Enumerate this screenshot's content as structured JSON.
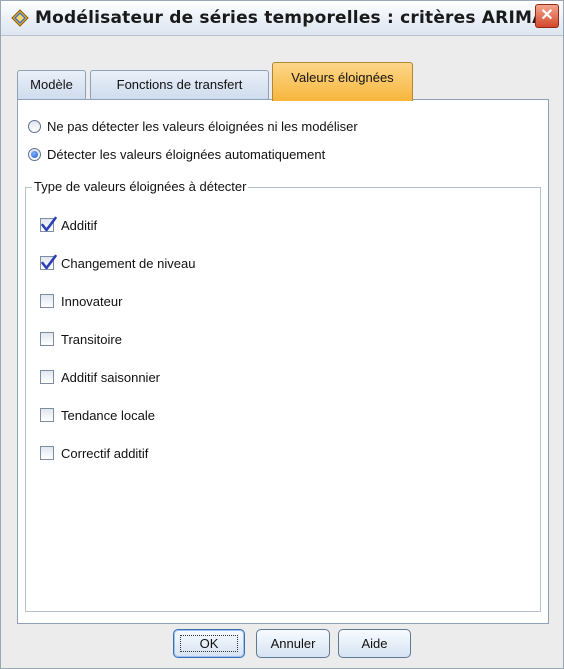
{
  "window": {
    "title": "Modélisateur de séries temporelles : critères ARIMA",
    "close_label": "✕"
  },
  "tabs": [
    {
      "label": "Modèle",
      "active": false
    },
    {
      "label": "Fonctions de transfert",
      "active": false
    },
    {
      "label": "Valeurs éloignées",
      "active": true
    }
  ],
  "detection": {
    "options": [
      {
        "label": "Ne pas détecter les valeurs éloignées ni les modéliser",
        "selected": false
      },
      {
        "label": "Détecter les valeurs éloignées automatiquement",
        "selected": true
      }
    ]
  },
  "outlier_types": {
    "legend": "Type de valeurs éloignées à détecter",
    "items": [
      {
        "label": "Additif",
        "checked": true
      },
      {
        "label": "Changement de niveau",
        "checked": true
      },
      {
        "label": "Innovateur",
        "checked": false
      },
      {
        "label": "Transitoire",
        "checked": false
      },
      {
        "label": "Additif saisonnier",
        "checked": false
      },
      {
        "label": "Tendance locale",
        "checked": false
      },
      {
        "label": "Correctif additif",
        "checked": false
      }
    ]
  },
  "buttons": {
    "ok": "OK",
    "cancel": "Annuler",
    "help": "Aide"
  },
  "colors": {
    "active_tab": "#f7b63b",
    "check_mark": "#2a3fb8",
    "close_button": "#d4482a"
  }
}
